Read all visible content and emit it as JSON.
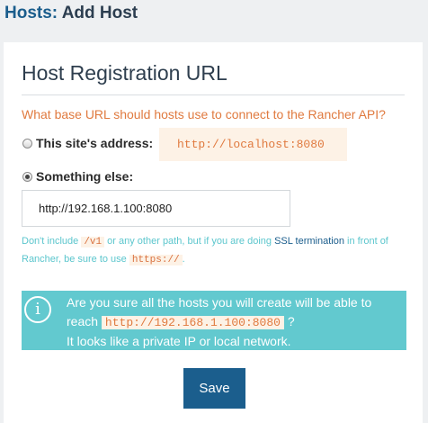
{
  "header": {
    "crumb": "Hosts:",
    "title": "Add Host"
  },
  "card": {
    "title": "Host Registration URL",
    "question": "What base URL should hosts use to connect to the Rancher API?",
    "option_site": {
      "label": "This site's address:",
      "value": "http://localhost:8080",
      "checked": false
    },
    "option_else": {
      "label": "Something else:",
      "checked": true
    },
    "url_input": {
      "value": "http://192.168.1.100:8080",
      "placeholder": ""
    },
    "help": {
      "part1": "Don't include ",
      "code1": "/v1",
      "part2": " or any other path, but if you are doing ",
      "link": "SSL termination",
      "part3": " in front of Rancher, be sure to use ",
      "code2": "https://",
      "part4": "."
    },
    "alert": {
      "icon": "info-icon",
      "line1": "Are you sure all the hosts you will create will be able to",
      "line2_prefix": "reach ",
      "line2_code": "http://192.168.1.100:8080",
      "line2_suffix": " ?",
      "line3": "It looks like a private IP or local network."
    },
    "save_label": "Save"
  },
  "colors": {
    "brand": "#1b5e8d",
    "accent": "#e07a3f",
    "info": "#62c9cf"
  }
}
